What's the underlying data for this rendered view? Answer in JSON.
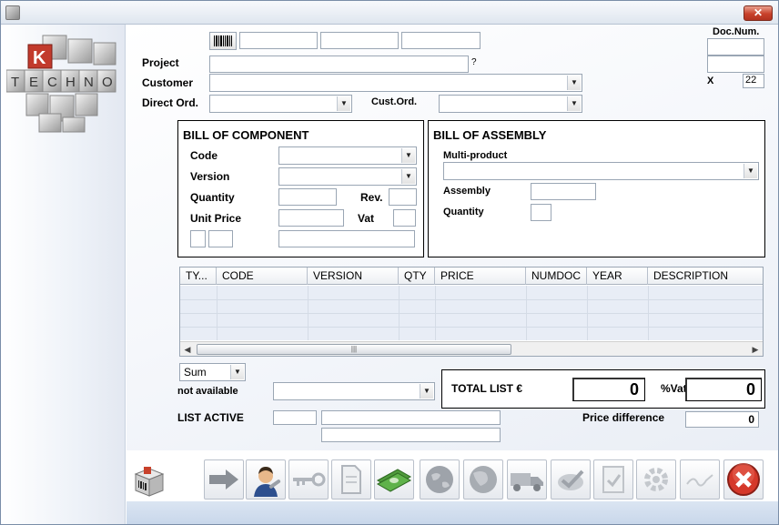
{
  "window": {
    "close_glyph": "✕"
  },
  "logo": {
    "letter_k": "K",
    "letters": [
      "T",
      "E",
      "C",
      "H",
      "N",
      "O"
    ]
  },
  "header": {
    "project_label": "Project",
    "project_hint": "?",
    "customer_label": "Customer",
    "direct_ord_label": "Direct Ord.",
    "cust_ord_label": "Cust.Ord.",
    "doc_num_label": "Doc.Num.",
    "x_label": "X",
    "x_value": "22"
  },
  "bill_of_component": {
    "title": "BILL OF COMPONENT",
    "code_label": "Code",
    "version_label": "Version",
    "quantity_label": "Quantity",
    "rev_label": "Rev.",
    "unit_price_label": "Unit Price",
    "vat_label": "Vat"
  },
  "bill_of_assembly": {
    "title": "BILL OF ASSEMBLY",
    "multi_product_label": "Multi-product",
    "assembly_label": "Assembly",
    "quantity_label": "Quantity"
  },
  "grid": {
    "columns": [
      "TY...",
      "CODE",
      "VERSION",
      "QTY",
      "PRICE",
      "NUMDOC",
      "YEAR",
      "DESCRIPTION"
    ],
    "scroll_grip": "|||"
  },
  "footer_form": {
    "sum_value": "Sum",
    "not_available_label": "not available",
    "list_active_label": "LIST ACTIVE",
    "total_list_label": "TOTAL LIST €",
    "total_value": "0",
    "vat_label": "%Vat",
    "vat_value": "0",
    "price_difference_label": "Price difference",
    "price_difference_value": "0"
  },
  "toolbar": {
    "icons": [
      "barcode-box-icon",
      "arrow-right-icon",
      "technician-icon",
      "key-icon",
      "document-icon",
      "money-icon",
      "globe-icon",
      "globe-2-icon",
      "truck-icon",
      "checkmark-icon",
      "clipboard-check-icon",
      "gear-icon",
      "signature-icon",
      "close-icon"
    ]
  },
  "colors": {
    "accent_red": "#c8412b",
    "footer_blue": "#c7d6ea",
    "grid_row": "#e8edf6"
  }
}
